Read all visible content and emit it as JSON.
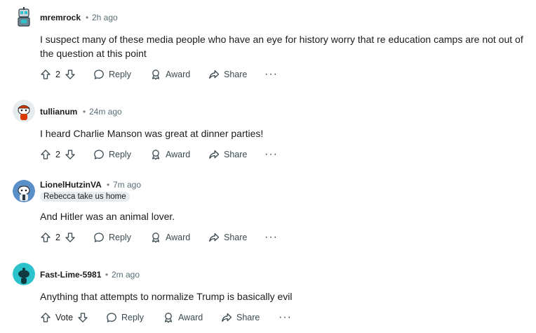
{
  "comments": [
    {
      "author": "mremrock",
      "separator": "•",
      "time": "2h ago",
      "text": "I suspect many of these media people who have an eye for history worry that re education camps are not out of the question at this point",
      "votes": "2",
      "reply": "Reply",
      "award": "Award",
      "share": "Share",
      "more": "···"
    },
    {
      "author": "tullianum",
      "separator": "•",
      "time": "24m ago",
      "text": "I heard Charlie Manson was great at dinner parties!",
      "votes": "2",
      "reply": "Reply",
      "award": "Award",
      "share": "Share",
      "more": "···"
    },
    {
      "author": "LionelHutzinVA",
      "separator": "•",
      "time": "7m ago",
      "flair": "Rebecca take us home",
      "text": "And Hitler was an animal lover.",
      "votes": "2",
      "reply": "Reply",
      "award": "Award",
      "share": "Share",
      "more": "···"
    },
    {
      "author": "Fast-Lime-5981",
      "separator": "•",
      "time": "2m ago",
      "text": "Anything that attempts to normalize Trump is basically evil",
      "votes": "Vote",
      "reply": "Reply",
      "award": "Award",
      "share": "Share",
      "more": "···"
    }
  ],
  "icons": {
    "upvote": "upvote-icon",
    "downvote": "downvote-icon",
    "reply": "comment-bubble-icon",
    "award": "award-icon",
    "share": "share-icon"
  },
  "colors": {
    "text": "#1c1c1c",
    "meta": "#576f76",
    "flair_bg": "#e5ebee",
    "avatar_teal": "#2bc2cc"
  }
}
